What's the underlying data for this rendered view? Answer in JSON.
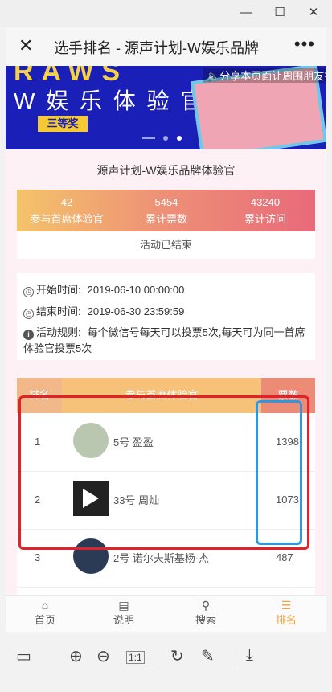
{
  "window": {
    "minimize": "—",
    "maximize": "☐",
    "close": "✕"
  },
  "navbar": {
    "close_icon": "close-icon",
    "title": "选手排名 - 源声计划-W娱乐品牌",
    "more_icon": "more-icon"
  },
  "banner": {
    "big_text": "RAWS",
    "subtitle": "W 娱 乐 体 验 官",
    "prize": "三等奖",
    "share_text": "分享本页面让周围朋友投"
  },
  "event_title": "源声计划-W娱乐品牌体验官",
  "stats": [
    {
      "value": "42",
      "label": "参与首席体验官"
    },
    {
      "value": "5454",
      "label": "累计票数"
    },
    {
      "value": "43240",
      "label": "累计访问"
    }
  ],
  "status_text": "活动已结束",
  "info": {
    "start_label": "开始时间:",
    "start_value": "2019-06-10 00:00:00",
    "end_label": "结束时间:",
    "end_value": "2019-06-30 23:59:59",
    "rule_label": "活动规则:",
    "rule_line1": "每个微信号每天可以投票5次,每天可为同一首席",
    "rule_line2": "体验官投票5次"
  },
  "ranking": {
    "headers": [
      "排名",
      "参与首席体验官",
      "票数"
    ],
    "rows": [
      {
        "rank": "1",
        "name": "5号 盈盈",
        "votes": "1398"
      },
      {
        "rank": "2",
        "name": "33号 周灿",
        "votes": "1073"
      },
      {
        "rank": "3",
        "name": "2号 诺尔夫斯基杨·杰",
        "votes": "487"
      }
    ]
  },
  "tabs": [
    {
      "icon": "home-icon",
      "label": "首页",
      "active": false
    },
    {
      "icon": "document-icon",
      "label": "说明",
      "active": false
    },
    {
      "icon": "search-icon",
      "label": "搜索",
      "active": false
    },
    {
      "icon": "list-icon",
      "label": "排名",
      "active": true
    }
  ],
  "viewer_toolbar": {
    "layout_icon": "layout-icon",
    "zoom_in_icon": "zoom-in-icon",
    "zoom_out_icon": "zoom-out-icon",
    "actual_size": "1:1",
    "rotate_icon": "rotate-icon",
    "edit_icon": "pencil-icon",
    "download_icon": "download-icon"
  },
  "colors": {
    "accent": "#f1a23c",
    "annotation_red": "#e3212b",
    "annotation_blue": "#2c98e0",
    "banner_blue": "#1a1fb8"
  }
}
